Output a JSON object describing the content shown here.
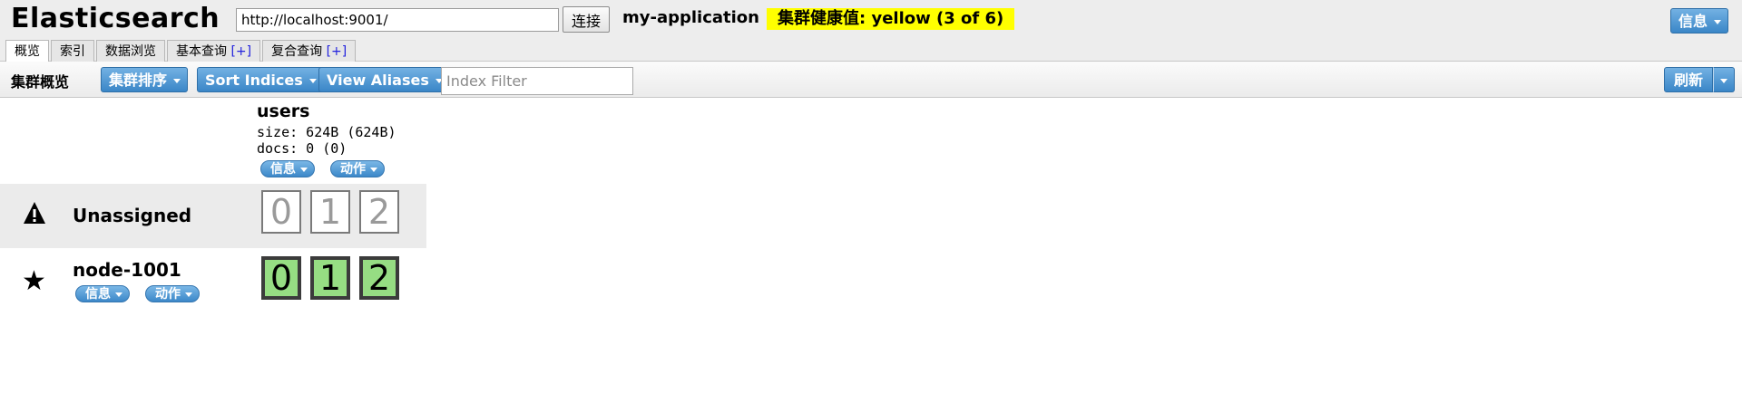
{
  "header": {
    "app_title": "Elasticsearch",
    "url_value": "http://localhost:9001/",
    "connect_label": "连接",
    "cluster_name": "my-application",
    "health_text": "集群健康值: yellow (3 of 6)",
    "info_label": "信息"
  },
  "tabs": [
    {
      "label": "概览",
      "active": true
    },
    {
      "label": "索引"
    },
    {
      "label": "数据浏览"
    },
    {
      "label": "基本查询",
      "plus": "[+]"
    },
    {
      "label": "复合查询",
      "plus": "[+]"
    }
  ],
  "toolbar": {
    "title": "集群概览",
    "sort_cluster_label": "集群排序",
    "sort_indices_label": "Sort Indices",
    "view_aliases_label": "View Aliases",
    "index_filter_placeholder": "Index Filter",
    "refresh_label": "刷新"
  },
  "index": {
    "name": "users",
    "size_text": "size: 624B (624B)",
    "docs_text": "docs: 0 (0)",
    "info_label": "信息",
    "action_label": "动作"
  },
  "rows": {
    "unassigned": {
      "label": "Unassigned",
      "icon": "warning-icon",
      "shards": [
        "0",
        "1",
        "2"
      ]
    },
    "node": {
      "name": "node-1001",
      "icon": "star-icon",
      "info_label": "信息",
      "action_label": "动作",
      "shards": [
        "0",
        "1",
        "2"
      ]
    }
  },
  "colors": {
    "health": "#ffff00",
    "button": "#3a86c7",
    "shard_started": "#96dd83"
  }
}
